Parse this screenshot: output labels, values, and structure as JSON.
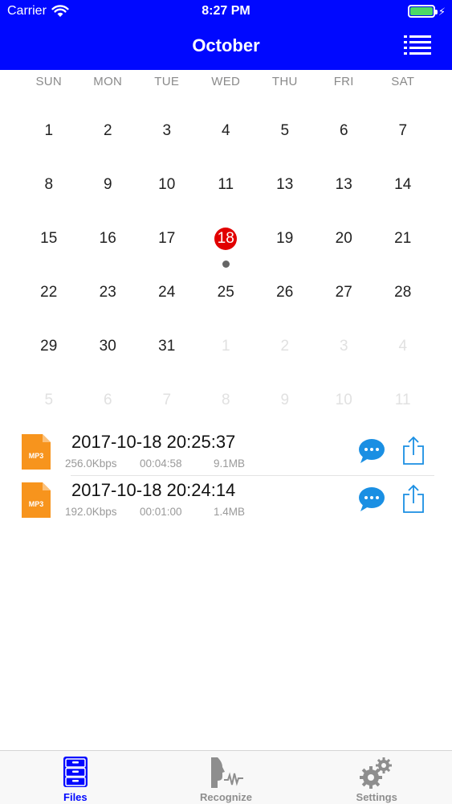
{
  "status_bar": {
    "carrier": "Carrier",
    "time": "8:27 PM",
    "battery_level": 1.0
  },
  "header": {
    "title": "October",
    "menu_icon": "list-icon",
    "background_color": "#0008ff"
  },
  "calendar": {
    "weekdays": [
      "SUN",
      "MON",
      "TUE",
      "WED",
      "THU",
      "FRI",
      "SAT"
    ],
    "weeks": [
      [
        {
          "d": "1"
        },
        {
          "d": "2"
        },
        {
          "d": "3"
        },
        {
          "d": "4"
        },
        {
          "d": "5"
        },
        {
          "d": "6"
        },
        {
          "d": "7"
        }
      ],
      [
        {
          "d": "8"
        },
        {
          "d": "9"
        },
        {
          "d": "10"
        },
        {
          "d": "11"
        },
        {
          "d": "13"
        },
        {
          "d": "13"
        },
        {
          "d": "14"
        }
      ],
      [
        {
          "d": "15"
        },
        {
          "d": "16"
        },
        {
          "d": "17"
        },
        {
          "d": "18",
          "selected": true,
          "dot": true
        },
        {
          "d": "19"
        },
        {
          "d": "20"
        },
        {
          "d": "21"
        }
      ],
      [
        {
          "d": "22"
        },
        {
          "d": "23"
        },
        {
          "d": "24"
        },
        {
          "d": "25"
        },
        {
          "d": "26"
        },
        {
          "d": "27"
        },
        {
          "d": "28"
        }
      ],
      [
        {
          "d": "29"
        },
        {
          "d": "30"
        },
        {
          "d": "31"
        },
        {
          "d": "1",
          "other": true
        },
        {
          "d": "2",
          "other": true
        },
        {
          "d": "3",
          "other": true
        },
        {
          "d": "4",
          "other": true
        }
      ],
      [
        {
          "d": "5",
          "other": true
        },
        {
          "d": "6",
          "other": true
        },
        {
          "d": "7",
          "other": true
        },
        {
          "d": "8",
          "other": true
        },
        {
          "d": "9",
          "other": true
        },
        {
          "d": "10",
          "other": true
        },
        {
          "d": "11",
          "other": true
        }
      ]
    ],
    "selected_color": "#e10000"
  },
  "recordings": [
    {
      "title": "2017-10-18 20:25:37",
      "bitrate": "256.0Kbps",
      "duration": "00:04:58",
      "size": "9.1MB",
      "file_icon_label": "MP3"
    },
    {
      "title": "2017-10-18 20:24:14",
      "bitrate": "192.0Kbps",
      "duration": "00:01:00",
      "size": "1.4MB",
      "file_icon_label": "MP3"
    }
  ],
  "tabbar": {
    "tabs": [
      {
        "label": "Files",
        "icon": "file-cabinet-icon",
        "active": true
      },
      {
        "label": "Recognize",
        "icon": "voice-recognize-icon",
        "active": false
      },
      {
        "label": "Settings",
        "icon": "gears-icon",
        "active": false
      }
    ],
    "active_color": "#0008ff"
  }
}
